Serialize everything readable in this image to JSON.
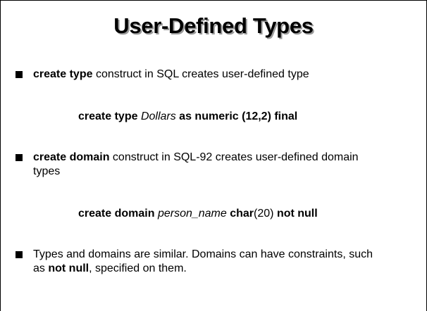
{
  "slide": {
    "title": "User-Defined Types",
    "bullets": [
      {
        "keyword": "create type",
        "rest": " construct in SQL creates user-defined type"
      },
      {
        "keyword": "create domain",
        "rest_line1": " construct in SQL-92 creates user-defined domain",
        "rest_line2": "types"
      },
      {
        "text_line1": "Types and domains are similar.  Domains can have constraints, such",
        "line2_prefix": "as ",
        "line2_bold": "not null",
        "line2_suffix": ", specified on them."
      }
    ],
    "example1": {
      "kw1": "create type ",
      "name": "Dollars",
      "kw2": " as numeric (12,2) final"
    },
    "example2": {
      "kw1": "create domain ",
      "name": "person_name",
      "kw2": " char",
      "arg": "(20) ",
      "kw3": "not null"
    }
  }
}
